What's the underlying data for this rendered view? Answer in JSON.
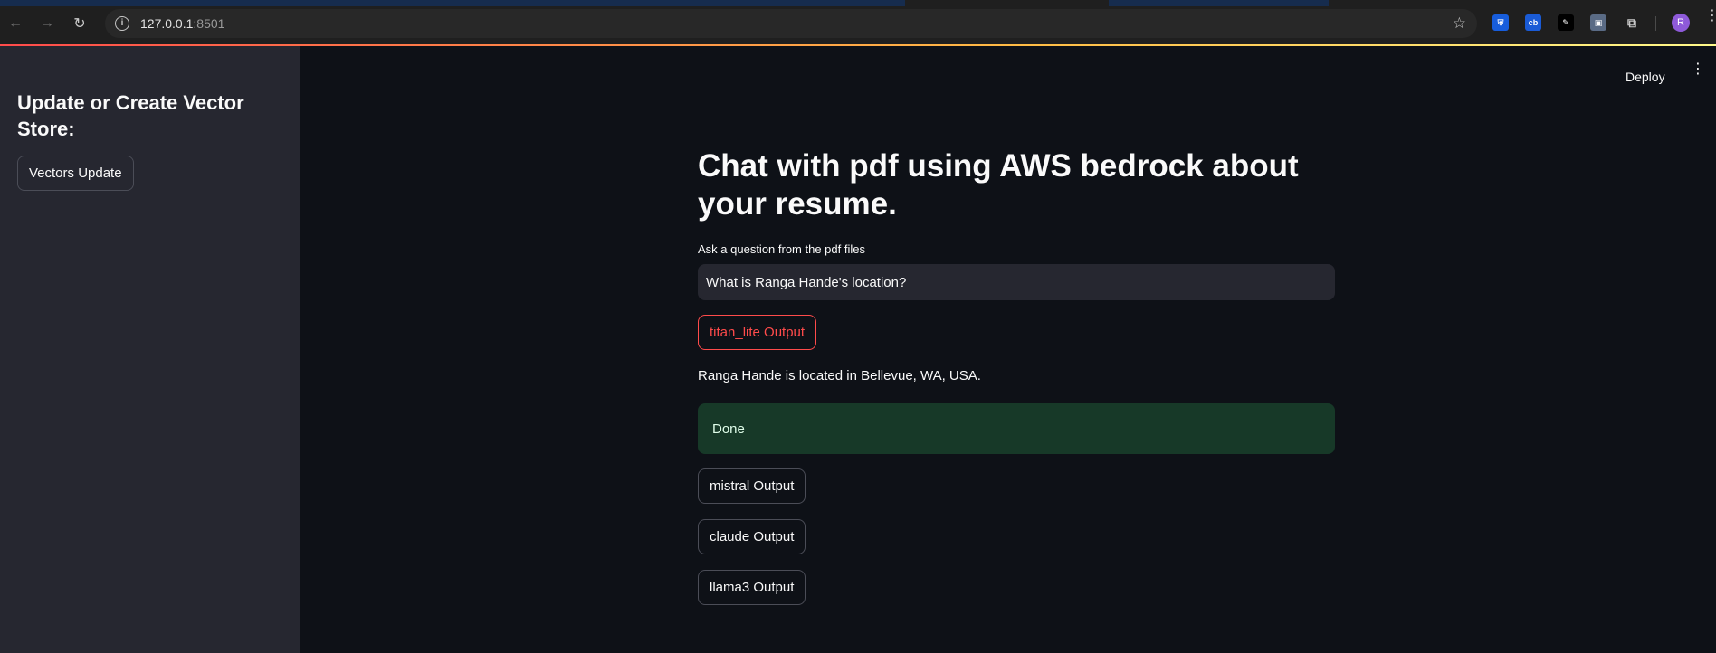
{
  "browser": {
    "url_host": "127.0.0.1",
    "url_port": ":8501",
    "extensions": [
      {
        "name": "bitwarden-icon",
        "color": "#175ddc",
        "glyph": "⛨"
      },
      {
        "name": "cb-extension-icon",
        "color": "#1a5bd6",
        "glyph": "cb"
      },
      {
        "name": "pen-extension-icon",
        "color": "#000000",
        "glyph": "✎"
      },
      {
        "name": "screen-capture-icon",
        "color": "#3a3a3a",
        "glyph": "▣"
      },
      {
        "name": "puzzle-extensions-icon",
        "color": "#1f1f1f",
        "glyph": "⧉"
      }
    ],
    "avatar_letter": "R"
  },
  "sidebar": {
    "title": "Update or Create Vector Store:",
    "button_label": "Vectors Update"
  },
  "header": {
    "deploy_label": "Deploy"
  },
  "main": {
    "title": "Chat with pdf using AWS bedrock about your resume.",
    "question_label": "Ask a question from the pdf files",
    "question_value": "What is Ranga Hande's location?",
    "buttons": {
      "titan": "titan_lite Output",
      "mistral": "mistral Output",
      "claude": "claude Output",
      "llama": "llama3 Output"
    },
    "answer": "Ranga Hande is located in Bellevue, WA, USA.",
    "status": "Done"
  },
  "colors": {
    "accent": "#ff4b4b",
    "success_bg": "#173928",
    "sidebar_bg": "#262730",
    "app_bg": "#0e1117"
  }
}
